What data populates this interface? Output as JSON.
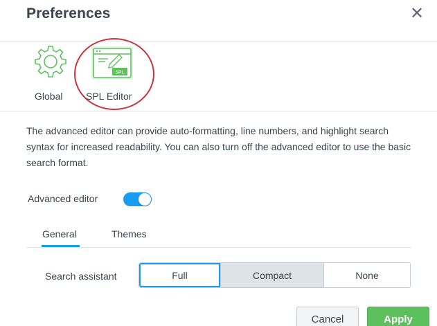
{
  "dialog": {
    "title": "Preferences",
    "close_icon": "close-icon"
  },
  "categories": [
    {
      "label": "Global",
      "icon": "gear-icon",
      "color": "#5cc05c"
    },
    {
      "label": "SPL Editor",
      "icon": "spl-editor-icon",
      "color": "#5cc05c",
      "selected": true
    }
  ],
  "highlight_color": "#c8343b",
  "description": "The advanced editor can provide auto-formatting, line numbers, and highlight search syntax for increased readability. You can also turn off the advanced editor to use the basic search format.",
  "advanced_editor": {
    "label": "Advanced editor",
    "enabled": true,
    "color": "#1a9cf3"
  },
  "tabs": [
    {
      "label": "General",
      "active": true
    },
    {
      "label": "Themes",
      "active": false
    }
  ],
  "search_assistant": {
    "label": "Search assistant",
    "options": [
      "Full",
      "Compact",
      "None"
    ],
    "selected": "Compact"
  },
  "icon_badge_text": "SPL",
  "footer": {
    "cancel_label": "Cancel",
    "apply_label": "Apply",
    "apply_color": "#5cc05c"
  }
}
